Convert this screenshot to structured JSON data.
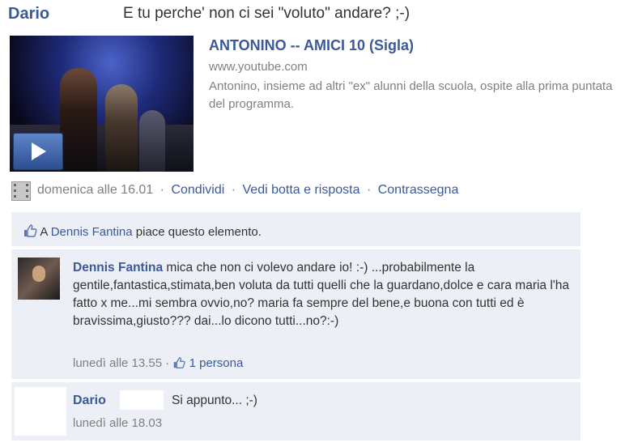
{
  "post": {
    "author": "Dario",
    "message": "E tu perche' non ci sei \"voluto\" andare? ;-)"
  },
  "video": {
    "title": "ANTONINO -- AMICI 10 (Sigla)",
    "url": "www.youtube.com",
    "description": "Antonino, insieme ad altri \"ex\" alunni della scuola, ospite alla prima puntata del programma."
  },
  "actions": {
    "timestamp": "domenica alle 16.01",
    "share": "Condividi",
    "see_thread": "Vedi botta e risposta",
    "flag": "Contrassegna",
    "separator": "·"
  },
  "likes": {
    "prefix": "A",
    "person": "Dennis Fantina",
    "suffix": "piace questo elemento."
  },
  "comments": [
    {
      "author": "Dennis Fantina",
      "text": "mica che non ci volevo andare io! :-) ...probabilmente la gentile,fantastica,stimata,ben voluta da tutti quelli che la guardano,dolce e cara maria l'ha fatto x me...mi sembra ovvio,no? maria fa sempre del bene,e buona con tutti ed è bravissima,giusto??? dai...lo dicono tutti...no?:-)",
      "timestamp": "lunedì alle 13.55",
      "likes": "1 persona"
    },
    {
      "author": "Dario",
      "text": "Si appunto... ;-)",
      "timestamp": "lunedì alle 18.03"
    }
  ],
  "colors": {
    "link": "#3b5998",
    "muted": "#808080",
    "panel": "#eceff5"
  }
}
